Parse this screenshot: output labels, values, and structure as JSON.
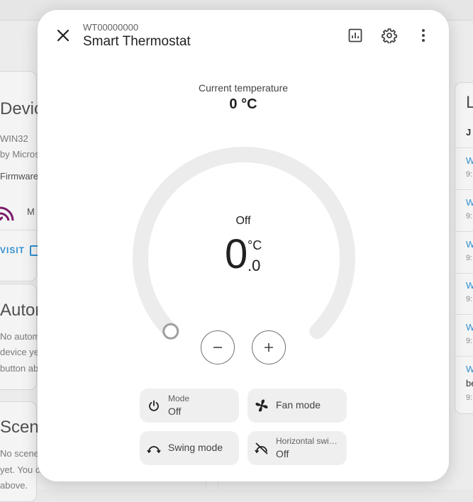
{
  "background": {
    "device_heading": "Device",
    "device_model": "WIN32",
    "manufacturer": "by Microso",
    "firmware": "Firmware:",
    "item_label": "M",
    "visit_link": "VISIT",
    "automations_heading": "Autom",
    "automations_text": [
      "No autom",
      "device yet",
      "button abo"
    ],
    "scenes_heading": "Scene",
    "scenes_text": [
      "No scenes",
      "yet. You ca",
      "above."
    ],
    "logbook_heading": "L",
    "logbook_subheading": "J",
    "logbook_items": [
      {
        "w": "W",
        "t": "9:"
      },
      {
        "w": "W",
        "t": "9:"
      },
      {
        "w": "W",
        "t": "9:"
      },
      {
        "w": "W",
        "t": "9:"
      },
      {
        "w": "W",
        "t": "9:"
      }
    ],
    "logbook_last": {
      "w": "W",
      "b": "be",
      "t": "9:"
    }
  },
  "dialog": {
    "subtitle": "WT00000000",
    "title": "Smart Thermostat",
    "icons": {
      "close": "close-icon",
      "history": "chart-icon",
      "settings": "gear-icon",
      "more": "more-vertical-icon"
    }
  },
  "current": {
    "label": "Current temperature",
    "value": "0",
    "unit": "°C"
  },
  "dial": {
    "state": "Off",
    "temp_integer": "0",
    "unit": "°C",
    "temp_decimal": ".0",
    "target_fraction": 0.0,
    "colors": {
      "track": "#ececec",
      "handle": "#9e9e9e"
    }
  },
  "controls": {
    "mode": {
      "label": "Mode",
      "value": "Off",
      "icon": "power-icon"
    },
    "fan": {
      "label": "Fan mode",
      "icon": "fan-icon"
    },
    "swing": {
      "label": "Swing mode",
      "icon": "swing-icon"
    },
    "hswing": {
      "label": "Horizontal swi…",
      "value": "Off",
      "icon": "swing-off-icon"
    }
  }
}
